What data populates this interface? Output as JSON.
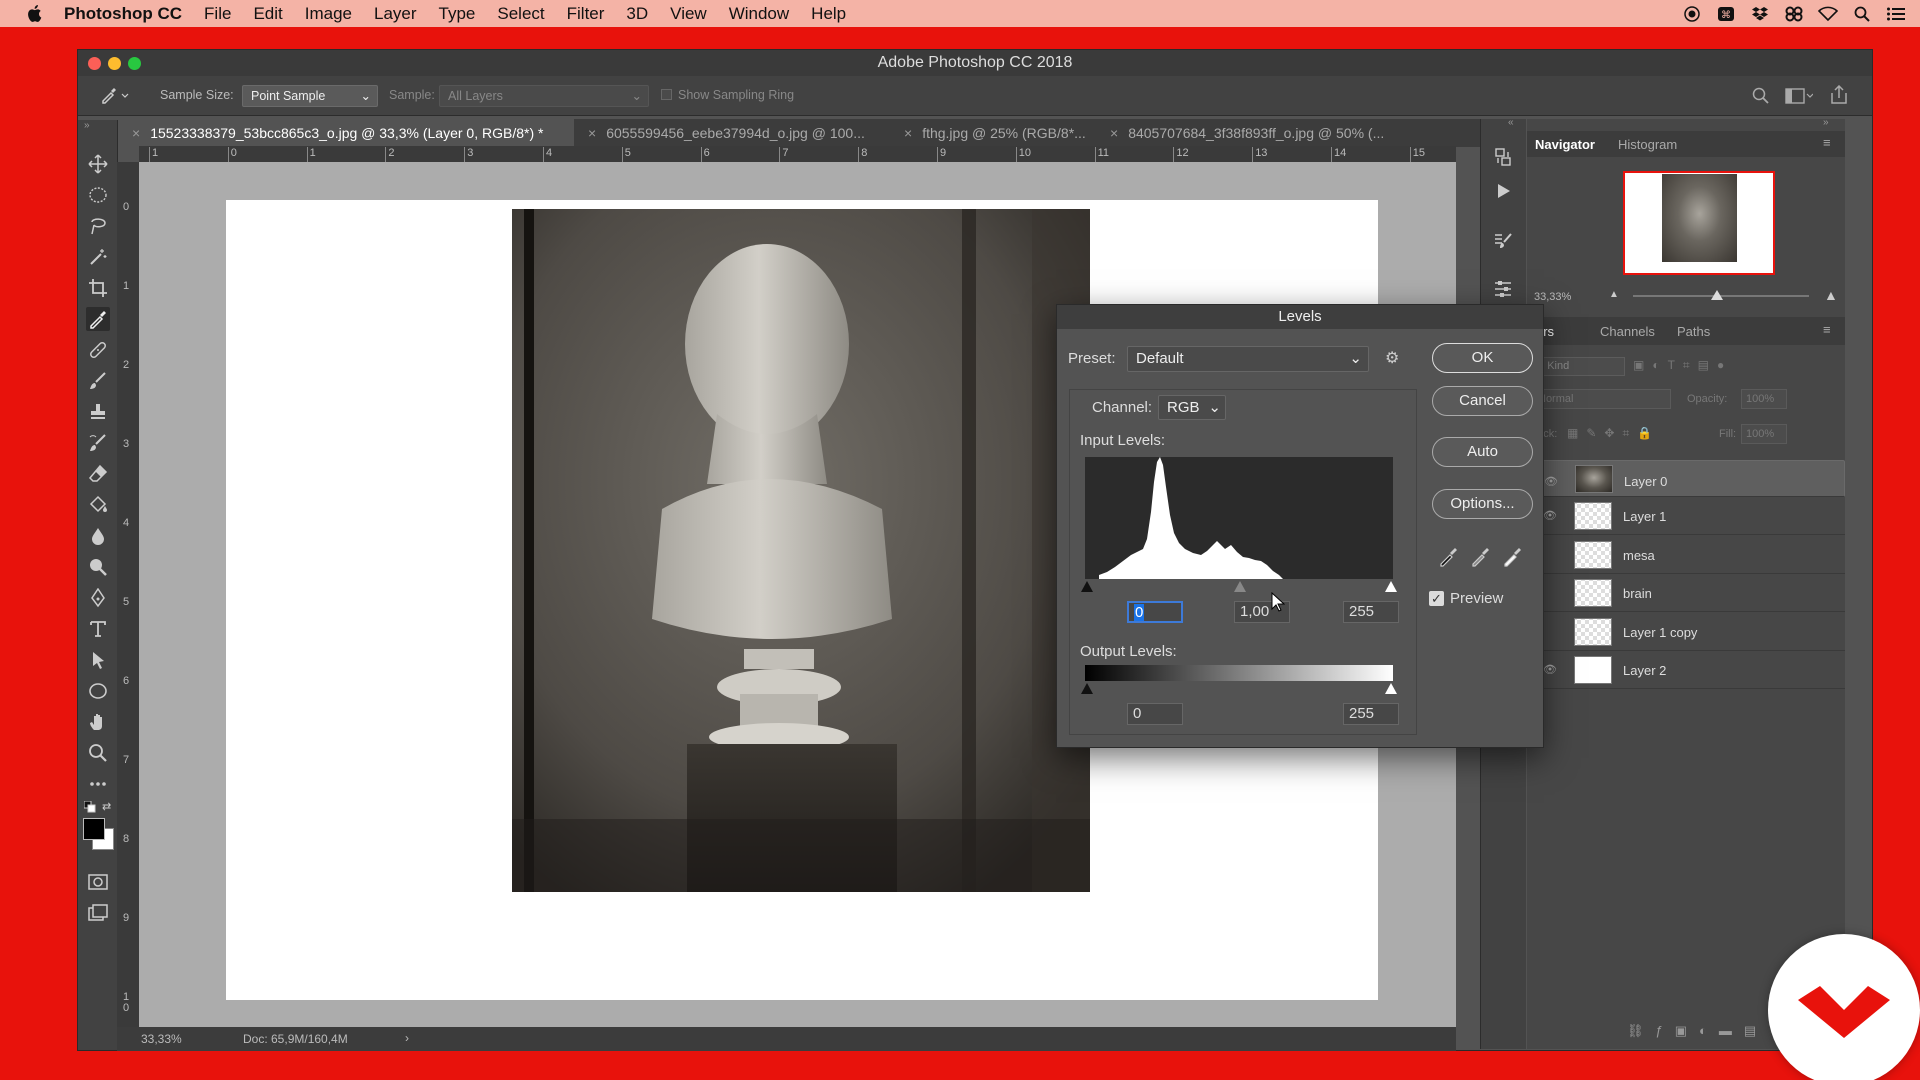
{
  "menubar": {
    "app_name": "Photoshop CC",
    "items": [
      "File",
      "Edit",
      "Image",
      "Layer",
      "Type",
      "Select",
      "Filter",
      "3D",
      "View",
      "Window",
      "Help"
    ]
  },
  "window": {
    "title": "Adobe Photoshop CC 2018"
  },
  "options_bar": {
    "sample_size_label": "Sample Size:",
    "sample_size_value": "Point Sample",
    "sample_label": "Sample:",
    "sample_value": "All Layers",
    "show_sampling_ring": "Show Sampling Ring"
  },
  "doc_tabs": [
    {
      "label": "15523338379_53bcc865c3_o.jpg @ 33,3% (Layer 0, RGB/8*) *"
    },
    {
      "label": "6055599456_eebe37994d_o.jpg @ 100..."
    },
    {
      "label": "fthg.jpg @ 25% (RGB/8*..."
    },
    {
      "label": "8405707684_3f38f893ff_o.jpg @ 50% (..."
    }
  ],
  "ruler_h": [
    "1",
    "0",
    "1",
    "2",
    "3",
    "4",
    "5",
    "6",
    "7",
    "8",
    "9",
    "10",
    "11",
    "12",
    "13",
    "14",
    "15"
  ],
  "ruler_v": [
    "0",
    "1",
    "2",
    "3",
    "4",
    "5",
    "6",
    "7",
    "8",
    "9",
    "1\n0"
  ],
  "status_bar": {
    "zoom": "33,33%",
    "doc": "Doc: 65,9M/160,4M",
    "arrow": "›"
  },
  "navigator": {
    "tabs": [
      "Navigator",
      "Histogram"
    ],
    "zoom": "33,33%",
    "zoom_fraction": 0.48
  },
  "layers_panel": {
    "tabs": [
      "Layers",
      "Channels",
      "Paths"
    ],
    "kind_label": "Kind",
    "blend_mode": "Normal",
    "opacity_label": "Opacity:",
    "opacity_value": "100%",
    "lock_label": "Lock:",
    "fill_label": "Fill:",
    "fill_value": "100%",
    "layers": [
      {
        "name": "Layer 0",
        "visible": true,
        "selected": true
      },
      {
        "name": "Layer 1",
        "visible": true,
        "selected": false
      },
      {
        "name": "mesa",
        "visible": false,
        "selected": false
      },
      {
        "name": "brain",
        "visible": false,
        "selected": false
      },
      {
        "name": "Layer 1 copy",
        "visible": false,
        "selected": false
      },
      {
        "name": "Layer 2",
        "visible": true,
        "selected": false
      }
    ]
  },
  "levels_dialog": {
    "title": "Levels",
    "preset_label": "Preset:",
    "preset_value": "Default",
    "channel_label": "Channel:",
    "channel_value": "RGB",
    "input_levels_label": "Input Levels:",
    "input_black": "0",
    "input_gamma": "1,00",
    "input_white": "255",
    "output_levels_label": "Output Levels:",
    "output_black": "0",
    "output_white": "255",
    "buttons": {
      "ok": "OK",
      "cancel": "Cancel",
      "auto": "Auto",
      "options": "Options..."
    },
    "preview_label": "Preview",
    "preview_checked": true
  },
  "colors": {
    "accent": "#1a73e8",
    "desktop": "#e8120c",
    "badge": "#e8120c"
  }
}
